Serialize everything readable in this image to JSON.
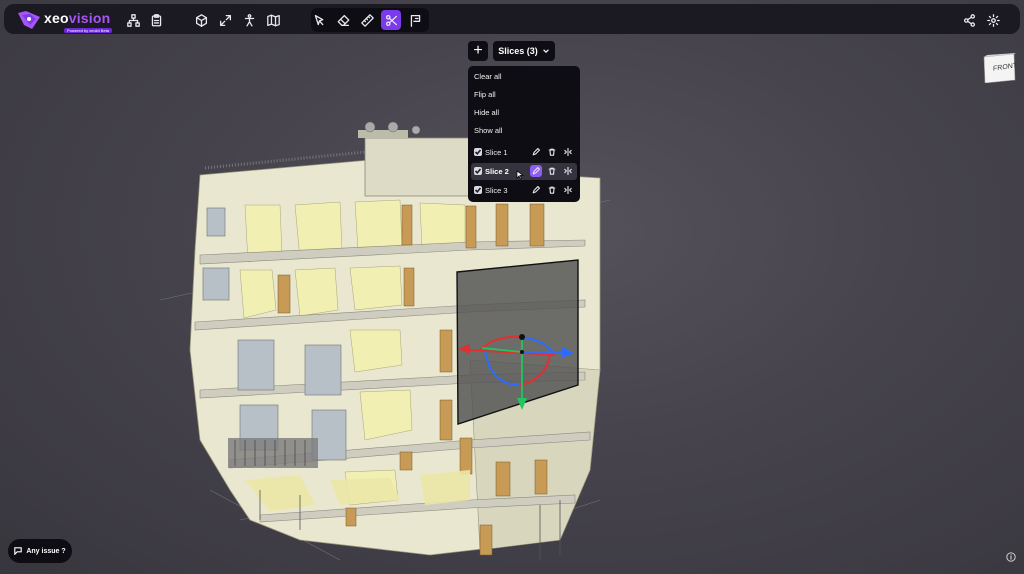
{
  "app": {
    "logo_text_a": "xeo",
    "logo_text_b": "vision",
    "logo_subtitle": "Powered by xeokit   Beta"
  },
  "toolbar": {
    "left_icons": [
      "hierarchy-icon",
      "clipboard-icon"
    ],
    "view_icons": [
      "cube-icon",
      "expand-icon",
      "person-icon",
      "map-icon"
    ],
    "tool_icons": [
      "select-pointer-icon",
      "eraser-icon",
      "ruler-icon",
      "scissors-icon",
      "annotation-flag-icon"
    ],
    "active_tool": "scissors-icon",
    "right_icons": [
      "share-icon",
      "settings-gear-icon"
    ]
  },
  "navcube": {
    "face_label": "FRONT"
  },
  "slices": {
    "add_label": "+",
    "dropdown_label": "Slices (3)",
    "menu_actions": [
      "Clear all",
      "Flip all",
      "Hide all",
      "Show all"
    ],
    "items": [
      {
        "label": "Slice 1",
        "checked": true,
        "highlighted": false,
        "editing": false
      },
      {
        "label": "Slice 2",
        "checked": true,
        "highlighted": true,
        "editing": true
      },
      {
        "label": "Slice 3",
        "checked": true,
        "highlighted": false,
        "editing": false
      }
    ]
  },
  "footer": {
    "issue_label": "Any issue ?"
  },
  "colors": {
    "accent": "#7c3aed",
    "toolbar_bg": "#1b1a22",
    "panel_bg": "#0e0d13",
    "viewport_bg": "#46434d"
  }
}
